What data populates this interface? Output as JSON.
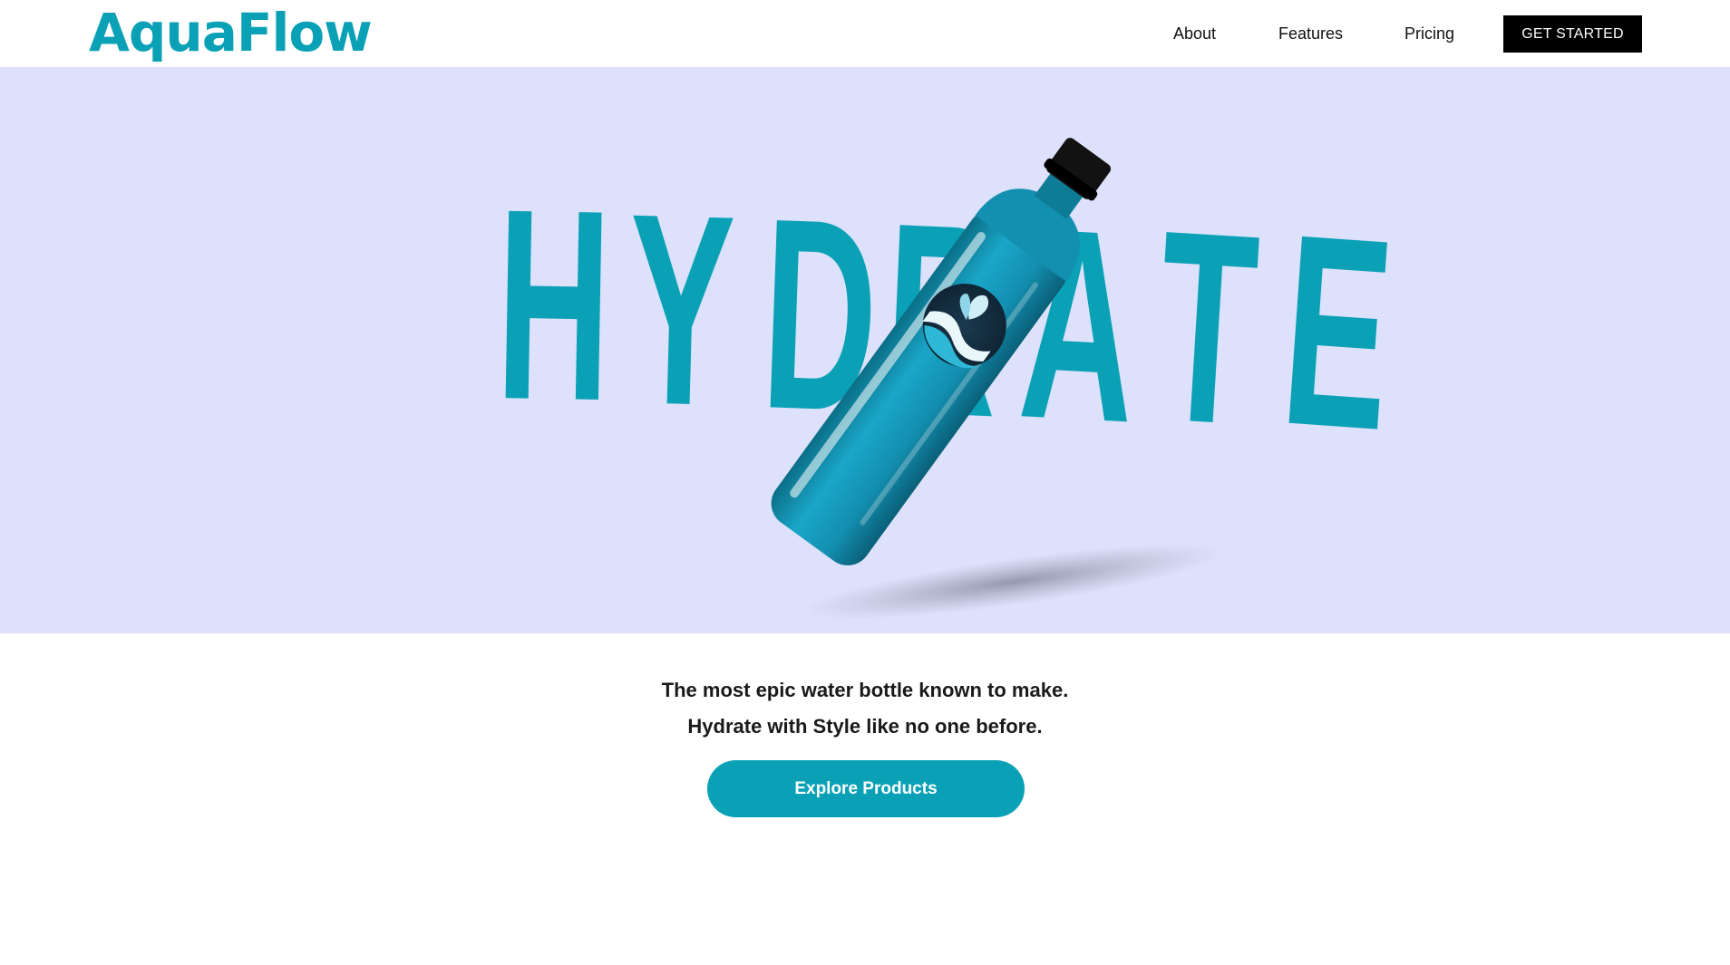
{
  "header": {
    "brand": "AquaFlow",
    "nav": {
      "about": "About",
      "features": "Features",
      "pricing": "Pricing"
    },
    "cta_label": "GET STARTED"
  },
  "hero": {
    "headline_letters": [
      "H",
      "Y",
      "D",
      "R",
      "A",
      "T",
      "E"
    ],
    "image_subject": "water-bottle-with-wave-logo",
    "background_color": "#dde1fb",
    "accent_color": "#0aa1b6"
  },
  "intro": {
    "line1": "The most epic water bottle known to make.",
    "line2": "Hydrate with Style like no one before.",
    "button_label": "Explore Products"
  }
}
